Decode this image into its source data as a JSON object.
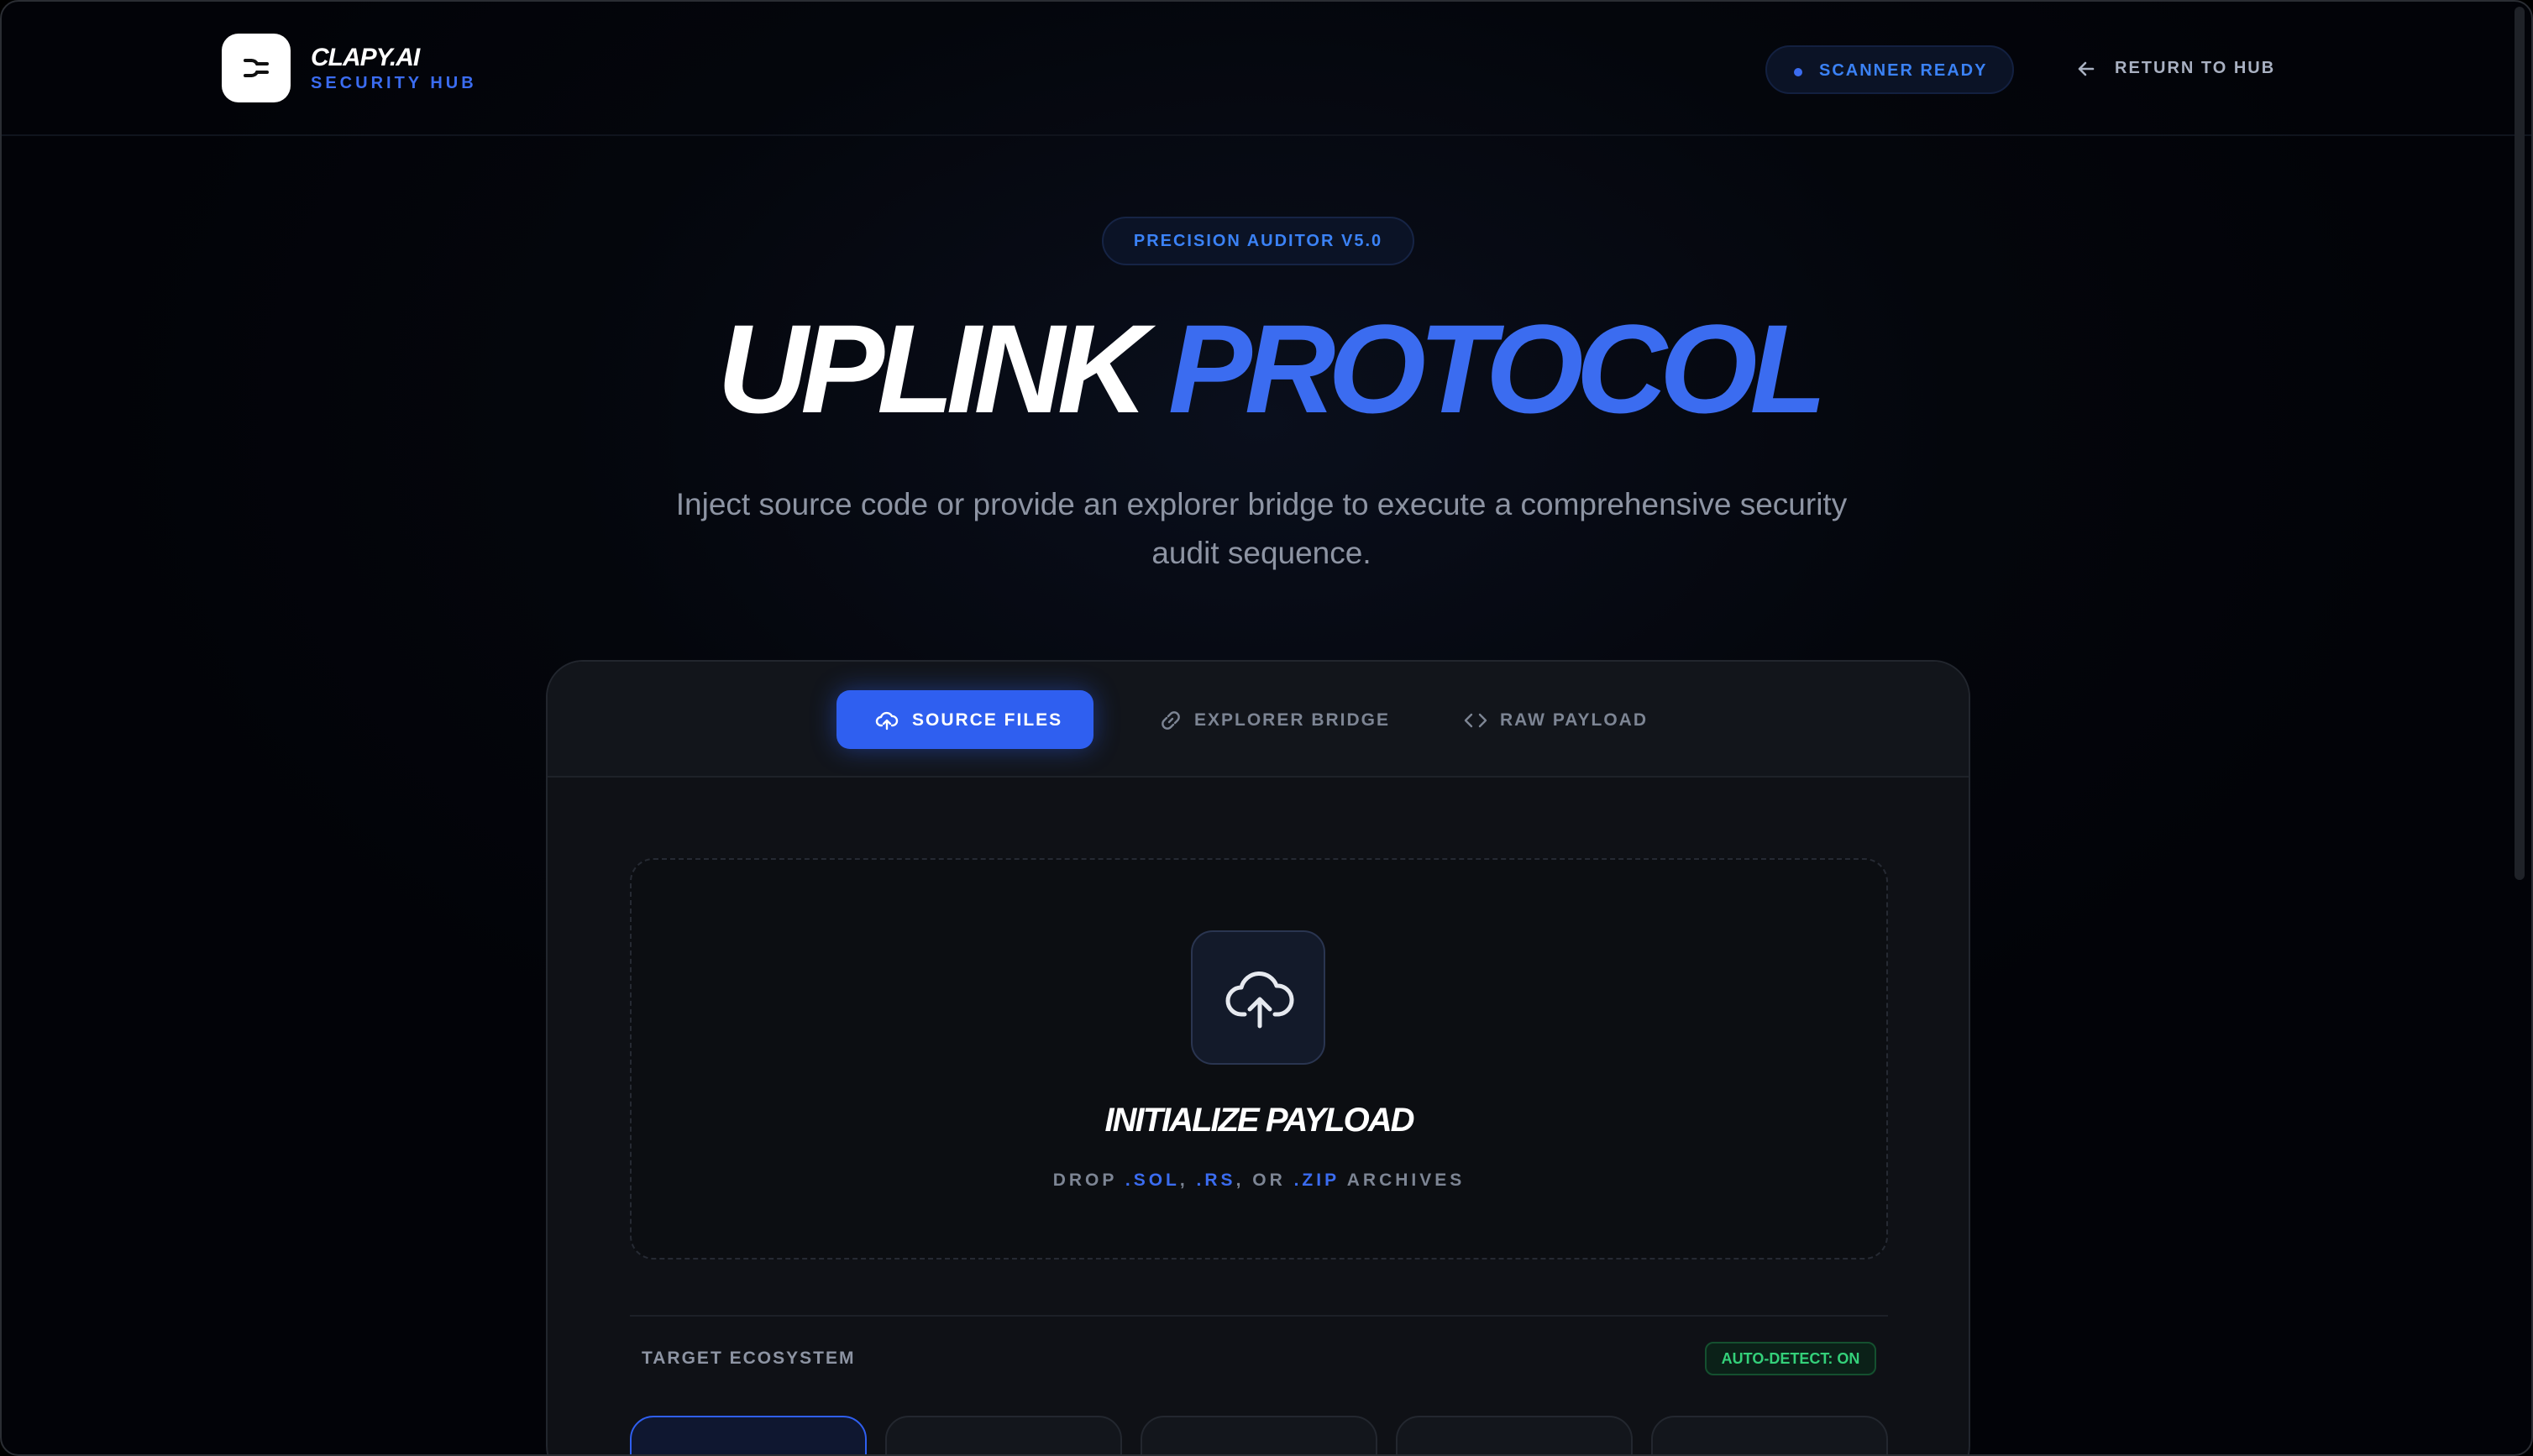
{
  "header": {
    "brand_name": "CLAPY.AI",
    "brand_sub": "SECURITY HUB",
    "logo_icon": "logo-mark-icon",
    "status": "SCANNER READY",
    "return_link": "RETURN TO HUB"
  },
  "hero": {
    "version": "PRECISION AUDITOR V5.0",
    "title_part1": "UPLINK",
    "title_part2": "PROTOCOL",
    "description": "Inject source code or provide an explorer bridge to execute a comprehensive security audit sequence."
  },
  "tabs": [
    {
      "label": "SOURCE FILES",
      "icon": "cloud-upload-icon",
      "active": true
    },
    {
      "label": "EXPLORER BRIDGE",
      "icon": "link-icon",
      "active": false
    },
    {
      "label": "RAW PAYLOAD",
      "icon": "code-icon",
      "active": false
    }
  ],
  "dropzone": {
    "title": "INITIALIZE PAYLOAD",
    "prefix": "DROP ",
    "ext1": ".SOL",
    "sep1": ", ",
    "ext2": ".RS",
    "sep2": ", OR ",
    "ext3": ".ZIP",
    "suffix": " ARCHIVES"
  },
  "ecosystem": {
    "label": "TARGET ECOSYSTEM",
    "auto_detect": "AUTO-DETECT: ON"
  },
  "colors": {
    "accent": "#3b6cf0",
    "success": "#34d17a",
    "background": "#04060c"
  }
}
